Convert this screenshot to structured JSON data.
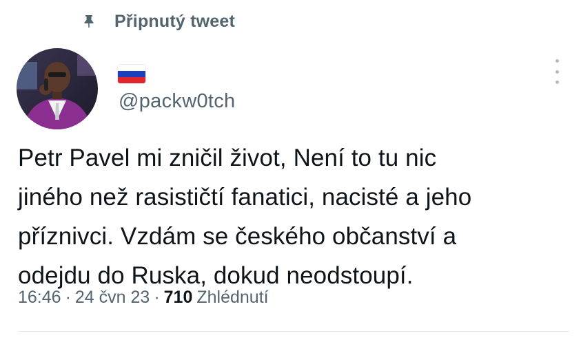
{
  "pinned": {
    "label": "Připnutý tweet",
    "icon": "pin-icon"
  },
  "author": {
    "flag_icon": "russia-flag-icon",
    "handle": "@packw0tch",
    "avatar_icon": "avatar-photo"
  },
  "tweet": {
    "lines": [
      "Petr Pavel mi zničil život, Není to tu nic",
      "jiného než rasističtí fanatici, nacisté a jeho",
      "příznivci. Vzdám se českého občanství a",
      "odejdu do Ruska, dokud neodstoupí."
    ]
  },
  "meta": {
    "time": "16:46",
    "separator": "·",
    "date": "24 čvn 23",
    "views_count": "710",
    "views_label": "Zhlédnutí"
  },
  "colors": {
    "secondary_text": "#536471",
    "primary_text": "#0f1419",
    "flag_white": "#ffffff",
    "flag_blue": "#1c3fbf",
    "flag_red": "#e0262c"
  }
}
